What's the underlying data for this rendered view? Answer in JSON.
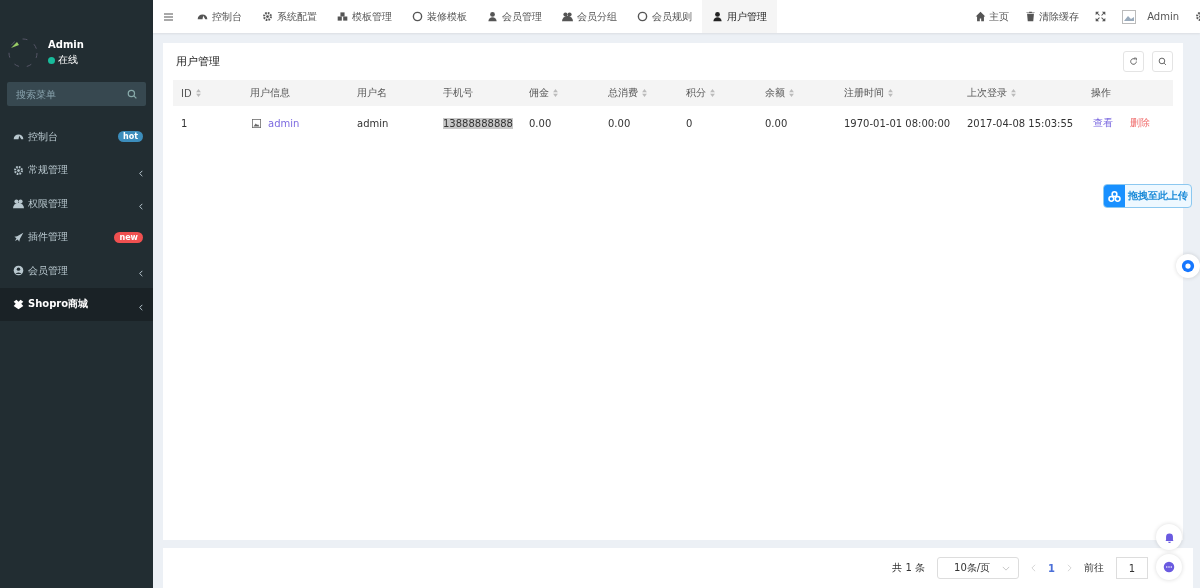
{
  "sidebar": {
    "user": {
      "name": "Admin",
      "status": "在线",
      "online": true
    },
    "search": {
      "placeholder": "搜索菜单"
    },
    "items": [
      {
        "label": "控制台",
        "badge": {
          "text": "hot",
          "color": "#3c8dbc"
        },
        "expandable": false,
        "selected": false
      },
      {
        "label": "常规管理",
        "expandable": true,
        "selected": false
      },
      {
        "label": "权限管理",
        "expandable": true,
        "selected": false
      },
      {
        "label": "插件管理",
        "badge": {
          "text": "new",
          "color": "#f05050"
        },
        "expandable": false,
        "selected": false
      },
      {
        "label": "会员管理",
        "expandable": true,
        "selected": false
      },
      {
        "label": "Shopro商城",
        "expandable": true,
        "selected": true
      }
    ]
  },
  "topbar": {
    "tabs": [
      {
        "label": "控制台",
        "selected": false
      },
      {
        "label": "系统配置",
        "selected": false
      },
      {
        "label": "模板管理",
        "selected": false
      },
      {
        "label": "装修模板",
        "selected": false
      },
      {
        "label": "会员管理",
        "selected": false
      },
      {
        "label": "会员分组",
        "selected": false
      },
      {
        "label": "会员规则",
        "selected": false
      },
      {
        "label": "用户管理",
        "selected": true
      }
    ],
    "actions": [
      {
        "kind": "home",
        "label": "主页"
      },
      {
        "kind": "trash",
        "label": "清除缓存"
      },
      {
        "kind": "fullscreen"
      },
      {
        "kind": "profile",
        "label": "Admin"
      },
      {
        "kind": "settings"
      }
    ]
  },
  "card": {
    "title": "用户管理",
    "table": {
      "columns": [
        {
          "label": "ID",
          "sortable": true
        },
        {
          "label": "用户信息",
          "sortable": false
        },
        {
          "label": "用户名",
          "sortable": false
        },
        {
          "label": "手机号",
          "sortable": false
        },
        {
          "label": "佣金",
          "sortable": true
        },
        {
          "label": "总消费",
          "sortable": true
        },
        {
          "label": "积分",
          "sortable": true
        },
        {
          "label": "余额",
          "sortable": true
        },
        {
          "label": "注册时间",
          "sortable": true
        },
        {
          "label": "上次登录",
          "sortable": true
        },
        {
          "label": "操作",
          "sortable": false
        }
      ],
      "rows": [
        {
          "id": "1",
          "nickname": "admin",
          "username": "admin",
          "phone": "13888888888",
          "phone_highlighted": true,
          "commission": "0.00",
          "total": "0.00",
          "points": "0",
          "balance": "0.00",
          "registered": "1970-01-01 08:00:00",
          "last_login": "2017-04-08 15:03:55",
          "actions": [
            {
              "label": "查看",
              "kind": "view"
            },
            {
              "label": "删除",
              "kind": "delete"
            }
          ]
        }
      ]
    }
  },
  "upload": {
    "label": "拖拽至此上传"
  },
  "pagination": {
    "total": "共 1 条",
    "page_size": "10条/页",
    "pages": [
      {
        "label": "1",
        "selected": true
      }
    ],
    "goto_label": "前往",
    "goto_value": "1"
  }
}
